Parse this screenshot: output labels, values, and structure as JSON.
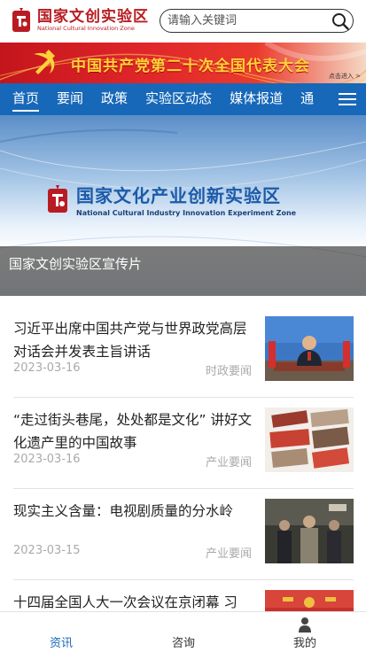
{
  "header": {
    "logo_title": "国家文创实验区",
    "logo_subtitle": "National Cultural Innovation Zone",
    "search_placeholder": "请输入关键词"
  },
  "banner": {
    "title": "中国共产党第二十次全国代表大会",
    "enter_label": "点击进入 >"
  },
  "nav": {
    "items": [
      {
        "label": "首页",
        "active": true
      },
      {
        "label": "要闻",
        "active": false
      },
      {
        "label": "政策",
        "active": false
      },
      {
        "label": "实验区动态",
        "active": false
      },
      {
        "label": "媒体报道",
        "active": false
      },
      {
        "label": "通",
        "active": false
      }
    ]
  },
  "hero": {
    "title_cn": "国家文化产业创新实验区",
    "title_en": "National Cultural Industry Innovation Experiment Zone",
    "caption": "国家文创实验区宣传片"
  },
  "news": [
    {
      "title": "习近平出席中国共产党与世界政党高层对话会并发表主旨讲话",
      "date": "2023-03-16",
      "category": "时政要闻",
      "thumb": "speech"
    },
    {
      "title": "“走过街头巷尾，处处都是文化” 讲好文化遗产里的中国故事",
      "date": "2023-03-16",
      "category": "产业要闻",
      "thumb": "street"
    },
    {
      "title": "现实主义含量：电视剧质量的分水岭",
      "date": "2023-03-15",
      "category": "产业要闻",
      "thumb": "drama"
    },
    {
      "title": "十四届全国人大一次会议在京闭幕 习",
      "date": "",
      "category": "",
      "thumb": "congress"
    }
  ],
  "tabbar": {
    "items": [
      {
        "label": "资讯",
        "active": true
      },
      {
        "label": "咨询",
        "active": false
      },
      {
        "label": "我的",
        "active": false
      }
    ]
  },
  "colors": {
    "brand_red": "#b81c22",
    "nav_blue": "#1768b8",
    "banner_gold": "#ffd23a"
  }
}
